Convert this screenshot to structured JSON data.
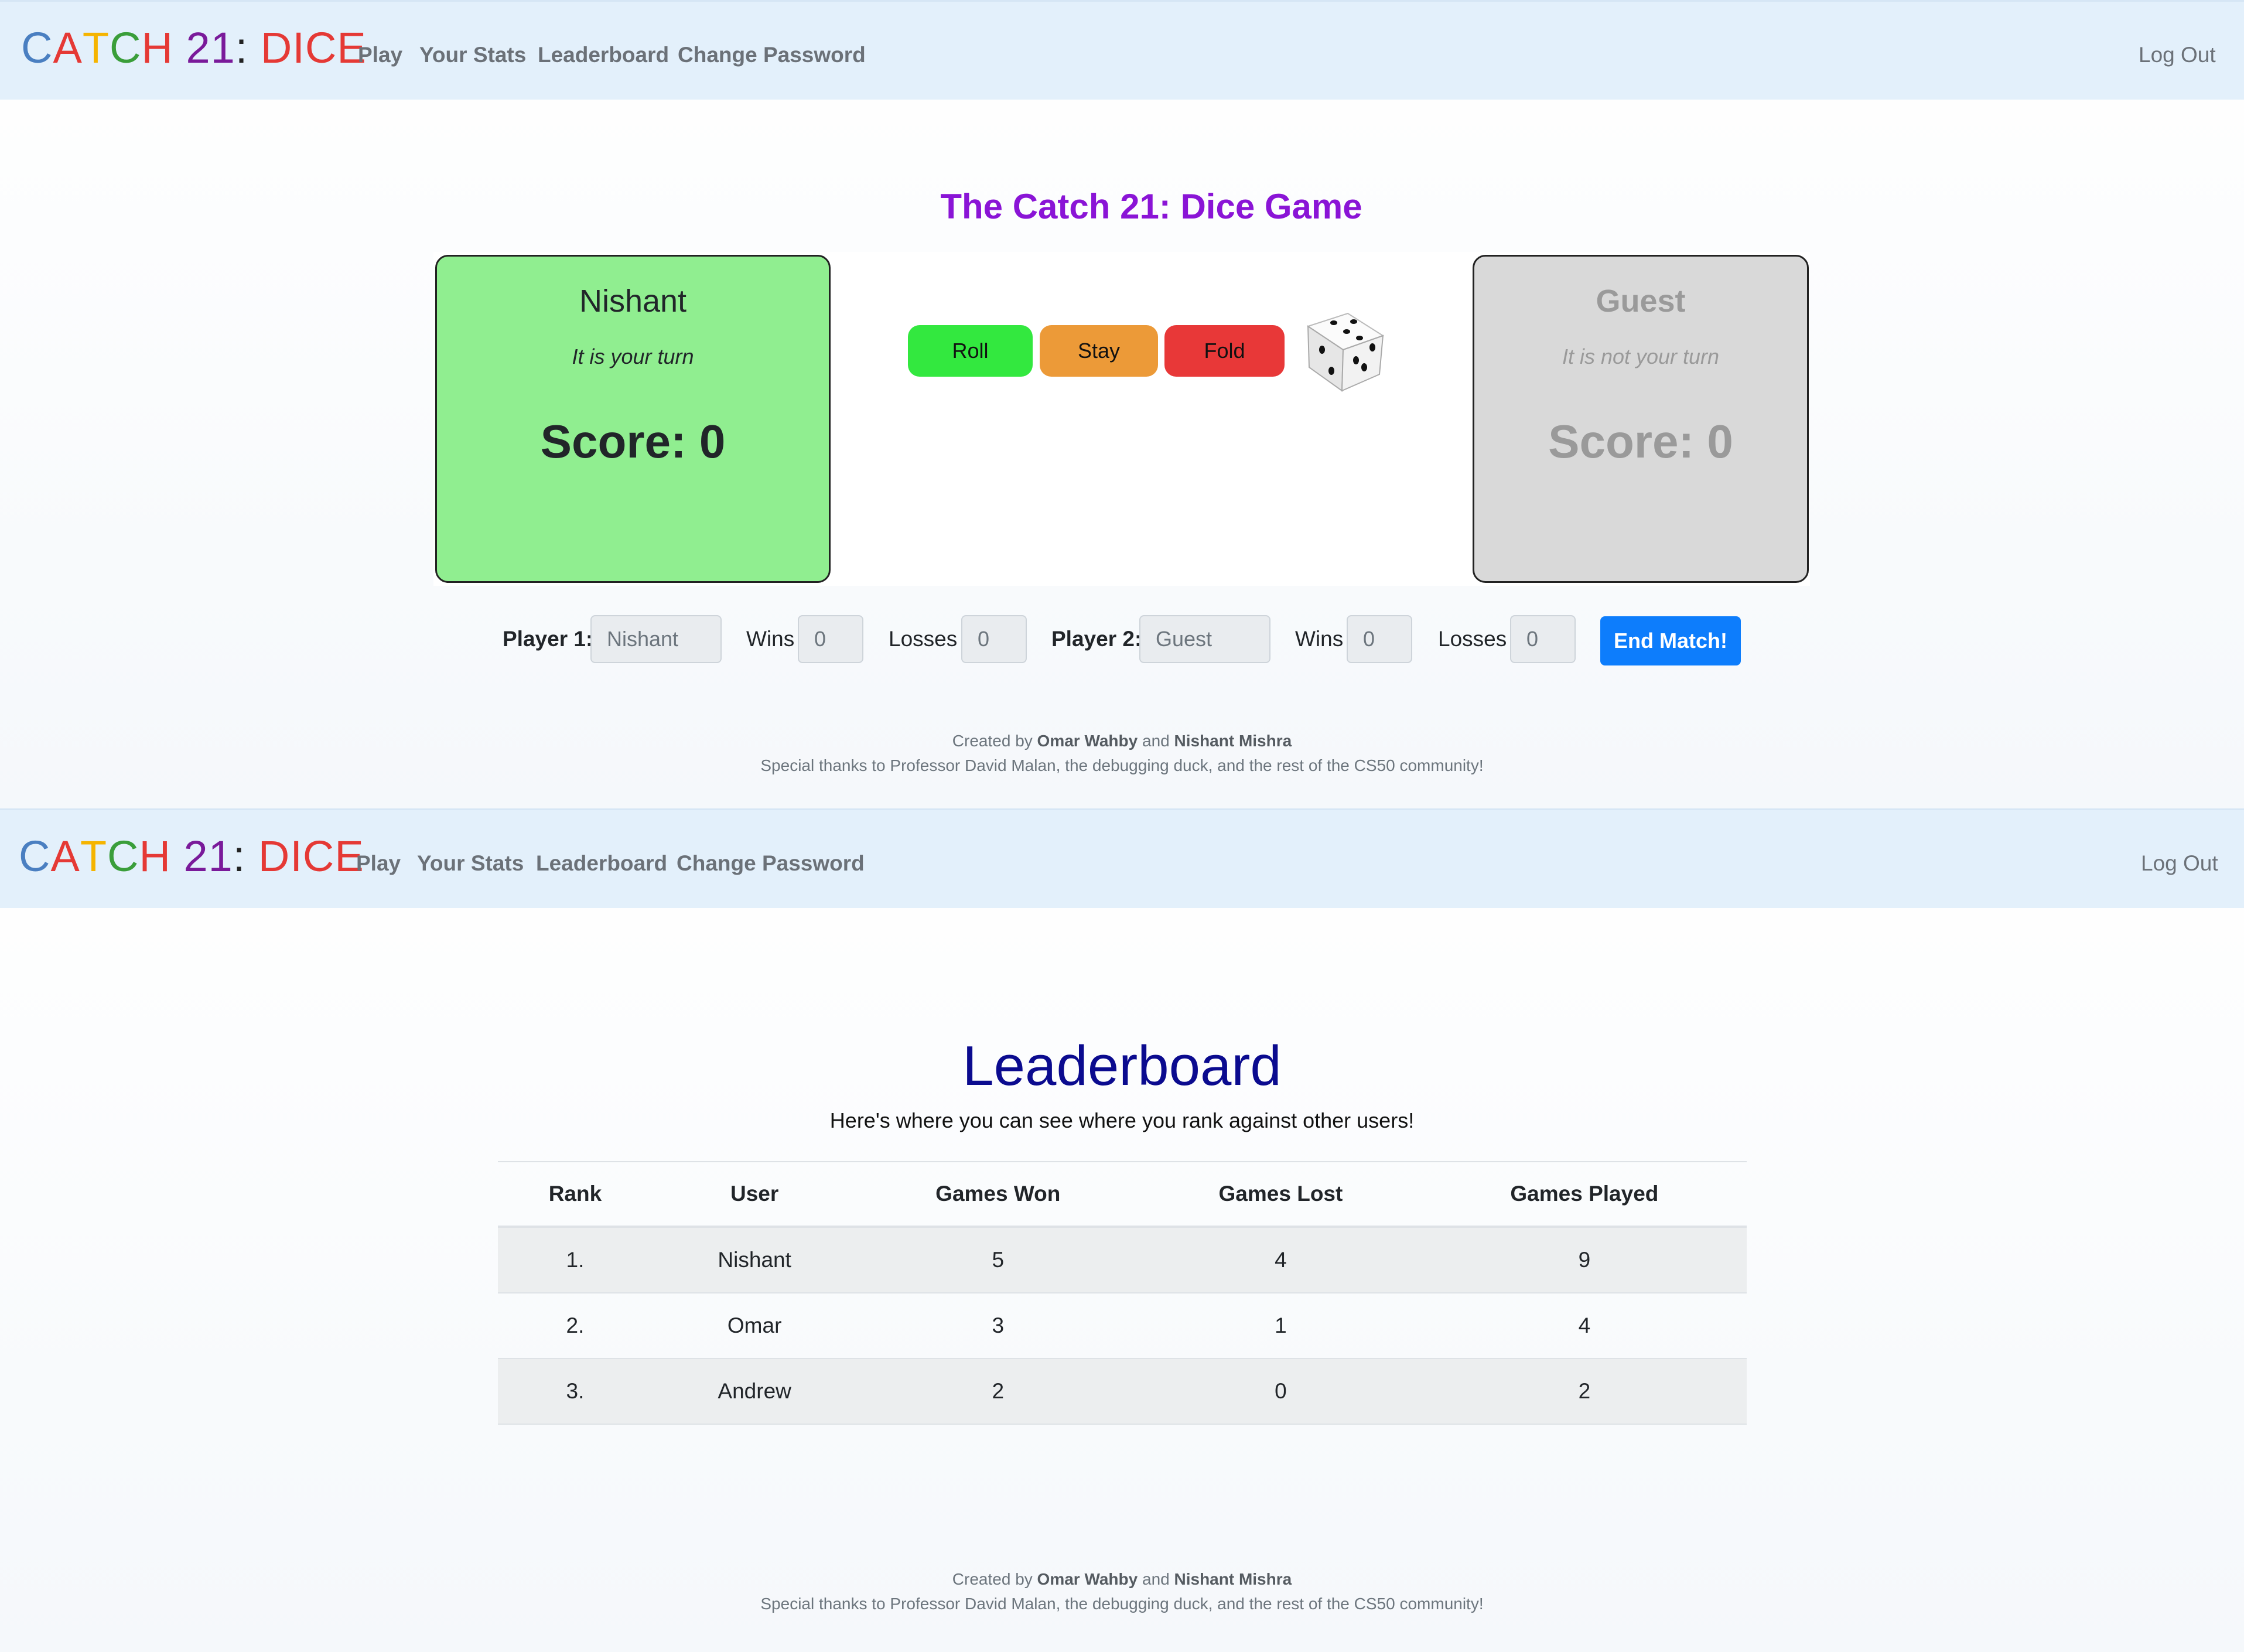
{
  "brand": {
    "segments": [
      {
        "text": "C",
        "color": "#4a7fc1"
      },
      {
        "text": "A",
        "color": "#e53935"
      },
      {
        "text": "T",
        "color": "#f5b400"
      },
      {
        "text": "C",
        "color": "#3a9e3a"
      },
      {
        "text": "H",
        "color": "#e53935"
      },
      {
        "text": " 21",
        "color": "#7a1a9a"
      },
      {
        "text": ": ",
        "color": "#222222"
      },
      {
        "text": "DICE",
        "color": "#e53935"
      }
    ]
  },
  "nav": {
    "play": "Play",
    "stats": "Your Stats",
    "leaderboard": "Leaderboard",
    "change_password": "Change Password",
    "logout": "Log Out"
  },
  "game": {
    "title": "The Catch 21: Dice Game",
    "player1": {
      "name": "Nishant",
      "turn": "It is your turn",
      "score": "Score: 0",
      "color": "#90ee90"
    },
    "player2": {
      "name": "Guest",
      "turn": "It is not your turn",
      "score": "Score: 0",
      "color": "#d9d9d9"
    },
    "buttons": {
      "roll": "Roll",
      "stay": "Stay",
      "fold": "Fold"
    },
    "dice_icon": "dice-icon"
  },
  "match_form": {
    "player1_label": "Player 1:",
    "player1_value": "Nishant",
    "wins_label": "Wins",
    "wins1_value": "0",
    "losses_label": "Losses",
    "losses1_value": "0",
    "player2_label": "Player 2:",
    "player2_value": "Guest",
    "wins2_value": "0",
    "losses2_value": "0",
    "end_button": "End Match!"
  },
  "footer": {
    "created_by": "Created by",
    "author1": "Omar Wahby",
    "and": "and",
    "author2": "Nishant Mishra",
    "thanks": "Special thanks to Professor David Malan, the debugging duck, and the rest of the CS50 community!"
  },
  "leaderboard": {
    "title": "Leaderboard",
    "subtitle": "Here's where you can see where you rank against other users!",
    "columns": [
      "Rank",
      "User",
      "Games Won",
      "Games Lost",
      "Games Played"
    ],
    "rows": [
      [
        "1.",
        "Nishant",
        "5",
        "4",
        "9"
      ],
      [
        "2.",
        "Omar",
        "3",
        "1",
        "4"
      ],
      [
        "3.",
        "Andrew",
        "2",
        "0",
        "2"
      ]
    ]
  }
}
